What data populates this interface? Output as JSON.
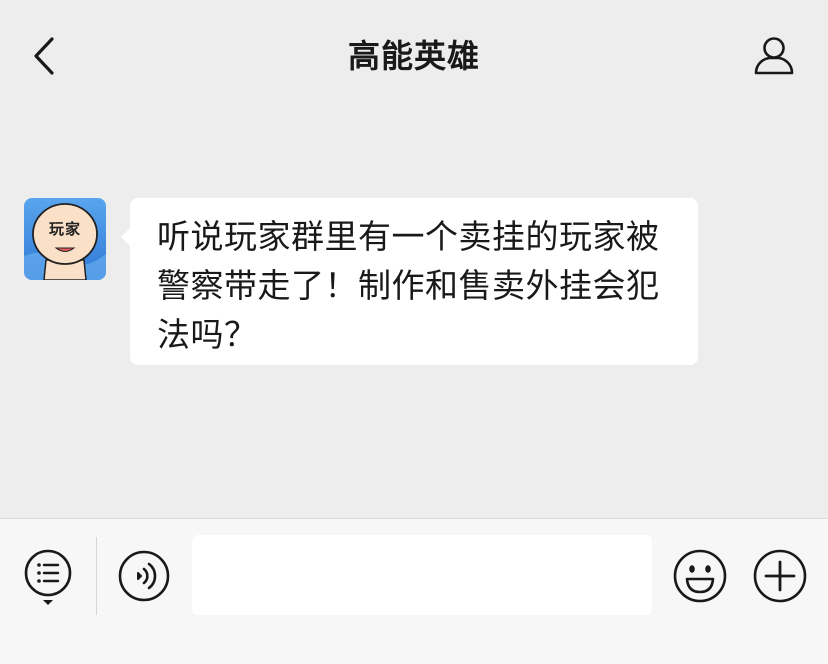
{
  "header": {
    "title": "高能英雄",
    "back_icon": "chevron-left-icon",
    "profile_icon": "person-icon"
  },
  "messages": [
    {
      "sender_avatar": {
        "label": "玩家",
        "background": "#3b8be0"
      },
      "text": "听说玩家群里有一个卖挂的玩家被警察带走了！制作和售卖外挂会犯法吗？"
    }
  ],
  "input_bar": {
    "menu_icon": "list-menu-icon",
    "voice_icon": "voice-icon",
    "input_value": "",
    "emoji_icon": "smiley-icon",
    "plus_icon": "plus-circle-icon"
  },
  "colors": {
    "background": "#ededed",
    "bubble": "#ffffff",
    "input_bar": "#f7f7f7",
    "icon": "#191919"
  }
}
